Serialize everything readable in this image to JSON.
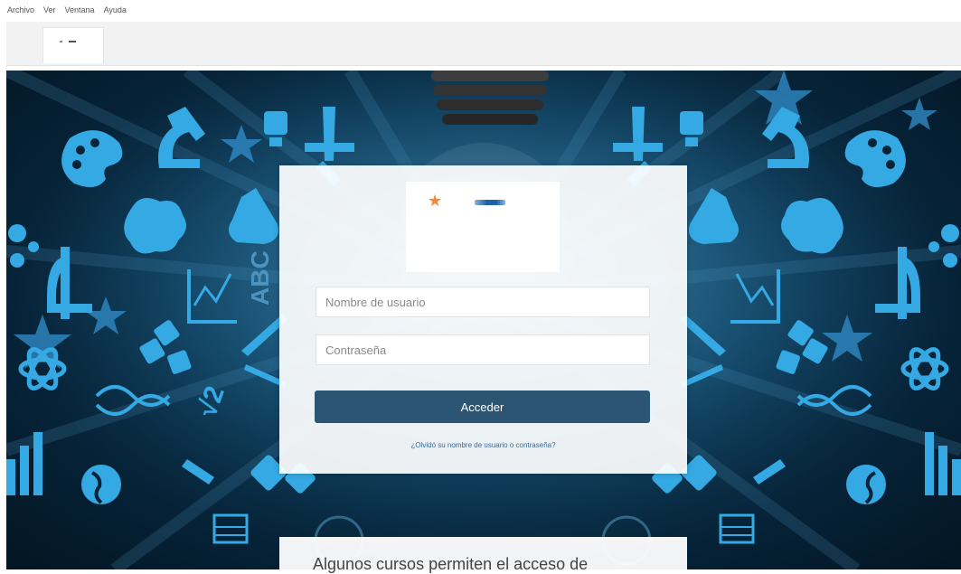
{
  "menubar": {
    "items": [
      "Archivo",
      "Ver",
      "Ventana",
      "Ayuda"
    ]
  },
  "login": {
    "username_placeholder": "Nombre de usuario",
    "password_placeholder": "Contraseña",
    "submit_label": "Acceder",
    "forgot_link": "¿Olvidó su nombre de usuario o contraseña?"
  },
  "info": {
    "guest_text": "Algunos cursos permiten el acceso de"
  },
  "colors": {
    "primary_button": "#2b5572",
    "background_dark": "#062338",
    "icon_blue": "#2fa8e0",
    "logo_star": "#f08a3c"
  }
}
